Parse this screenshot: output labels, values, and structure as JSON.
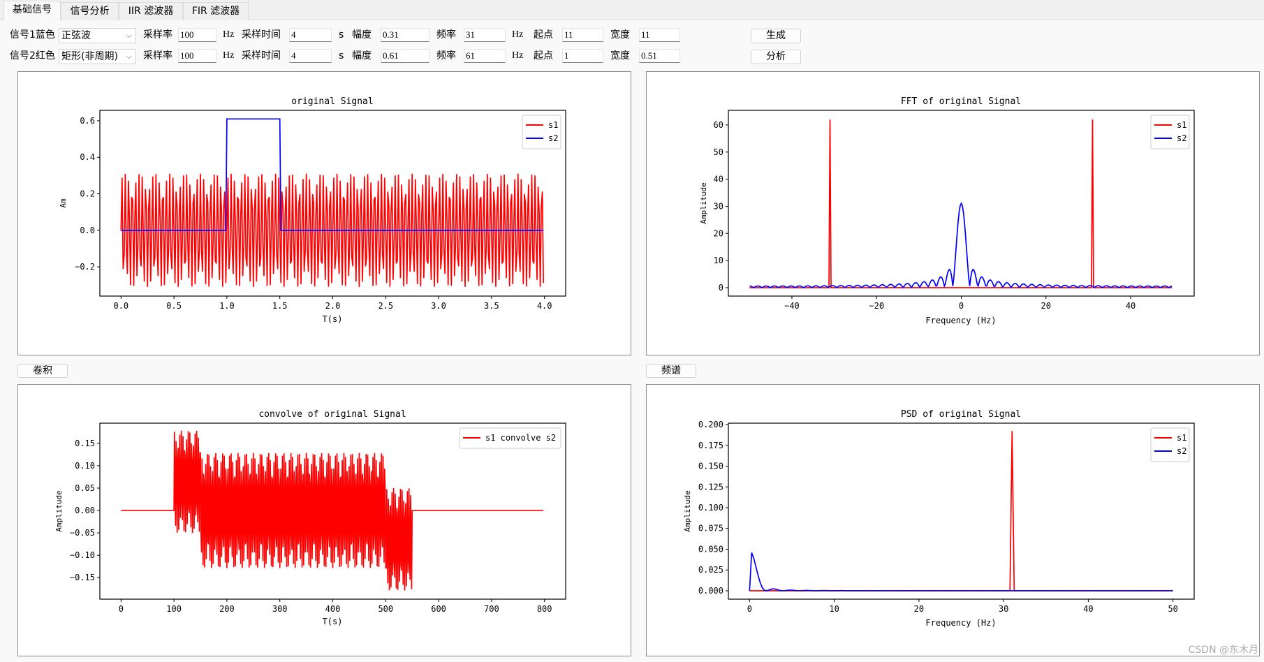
{
  "tabs": [
    {
      "label": "基础信号",
      "active": true
    },
    {
      "label": "信号分析"
    },
    {
      "label": "IIR 滤波器"
    },
    {
      "label": "FIR 滤波器"
    }
  ],
  "controls": {
    "rows": [
      {
        "label": "信号1蓝色",
        "waveform": "正弦波",
        "fs_label": "采样率",
        "fs": "100",
        "fs_unit": "Hz",
        "duration_label": "采样时间",
        "duration": "4",
        "duration_unit": "s",
        "amp_label": "幅度",
        "amp": "0.31",
        "freq_label": "频率",
        "freq": "31",
        "freq_unit": "Hz",
        "start_label": "起点",
        "start": "11",
        "width_label": "宽度",
        "width": "11"
      },
      {
        "label": "信号2红色",
        "waveform": "矩形(非周期)",
        "fs_label": "采样率",
        "fs": "100",
        "fs_unit": "Hz",
        "duration_label": "采样时间",
        "duration": "4",
        "duration_unit": "s",
        "amp_label": "幅度",
        "amp": "0.61",
        "freq_label": "频率",
        "freq": "61",
        "freq_unit": "Hz",
        "start_label": "起点",
        "start": "1",
        "width_label": "宽度",
        "width": "0.51"
      }
    ],
    "generate_label": "生成",
    "analyze_label": "分析"
  },
  "convolve_button": "卷积",
  "spectrum_button": "频谱",
  "watermark": "CSDN @东木月",
  "colors": {
    "s1": "#ff0000",
    "s2": "#0000ff"
  },
  "chart_data": [
    {
      "type": "line",
      "title": "original Signal",
      "xlabel": "T(s)",
      "ylabel": "Am",
      "xlim": [
        -0.2,
        4.2
      ],
      "ylim": [
        -0.36,
        0.657
      ],
      "xticks": [
        0,
        0.5,
        1,
        1.5,
        2,
        2.5,
        3,
        3.5,
        4
      ],
      "xticklabels": [
        "0.0",
        "0.5",
        "1.0",
        "1.5",
        "2.0",
        "2.5",
        "3.0",
        "3.5",
        "4.0"
      ],
      "yticks": [
        -0.2,
        0,
        0.2,
        0.4,
        0.6
      ],
      "yticklabels": [
        "−0.2",
        "0.0",
        "0.2",
        "0.4",
        "0.6"
      ],
      "legend": [
        "s1",
        "s2"
      ],
      "legend_position": "top-right",
      "series": [
        {
          "name": "s1",
          "color": "#ff0000",
          "signal": "0.31·sin(2π·31·t), fs=100, 0–4 s"
        },
        {
          "name": "s2",
          "color": "#0000ff",
          "signal": "0.61 rectangle from 1 s, width 0.51 s"
        }
      ]
    },
    {
      "type": "line",
      "title": "FFT of original Signal",
      "xlabel": "Frequency (Hz)",
      "ylabel": "Amplitude",
      "xlim": [
        -55,
        55
      ],
      "ylim": [
        -3.1,
        65.4
      ],
      "xticks": [
        -40,
        -20,
        0,
        20,
        40
      ],
      "xticklabels": [
        "−40",
        "−20",
        "0",
        "20",
        "40"
      ],
      "yticks": [
        0,
        10,
        20,
        30,
        40,
        50,
        60
      ],
      "yticklabels": [
        "0",
        "10",
        "20",
        "30",
        "40",
        "50",
        "60"
      ],
      "legend": [
        "s1",
        "s2"
      ],
      "legend_position": "top-right",
      "series": [
        {
          "name": "s1",
          "color": "#ff0000",
          "peaks": [
            [
              -31,
              62
            ],
            [
              31,
              62
            ]
          ]
        },
        {
          "name": "s2",
          "color": "#0000ff",
          "peaks": [
            [
              0,
              31
            ]
          ]
        }
      ]
    },
    {
      "type": "line",
      "title": "convolve of original Signal",
      "xlabel": "T(s)",
      "ylabel": "Amplitude",
      "xlim": [
        -40,
        840
      ],
      "ylim": [
        -0.198,
        0.195
      ],
      "xticks": [
        0,
        100,
        200,
        300,
        400,
        500,
        600,
        700,
        800
      ],
      "xticklabels": [
        "0",
        "100",
        "200",
        "300",
        "400",
        "500",
        "600",
        "700",
        "800"
      ],
      "yticks": [
        -0.15,
        -0.1,
        -0.05,
        0,
        0.05,
        0.1,
        0.15
      ],
      "yticklabels": [
        "−0.15",
        "−0.10",
        "−0.05",
        "0.00",
        "0.05",
        "0.10",
        "0.15"
      ],
      "legend": [
        "s1 convolve s2"
      ],
      "legend_position": "top-right",
      "series": [
        {
          "name": "s1 convolve s2",
          "color": "#ff0000"
        }
      ]
    },
    {
      "type": "line",
      "title": "PSD of original Signal",
      "xlabel": "Frequency (Hz)",
      "ylabel": "Amplitude",
      "xlim": [
        -2.5,
        52.5
      ],
      "ylim": [
        -0.0101,
        0.2017
      ],
      "xticks": [
        0,
        10,
        20,
        30,
        40,
        50
      ],
      "xticklabels": [
        "0",
        "10",
        "20",
        "30",
        "40",
        "50"
      ],
      "yticks": [
        0,
        0.025,
        0.05,
        0.075,
        0.1,
        0.125,
        0.15,
        0.175,
        0.2
      ],
      "yticklabels": [
        "0.000",
        "0.025",
        "0.050",
        "0.075",
        "0.100",
        "0.125",
        "0.150",
        "0.175",
        "0.200"
      ],
      "legend": [
        "s1",
        "s2"
      ],
      "legend_position": "top-right",
      "series": [
        {
          "name": "s1",
          "color": "#ff0000",
          "peaks": [
            [
              31,
              0.193
            ]
          ]
        },
        {
          "name": "s2",
          "color": "#0000ff",
          "peaks": [
            [
              0.25,
              0.046
            ]
          ]
        }
      ]
    }
  ]
}
